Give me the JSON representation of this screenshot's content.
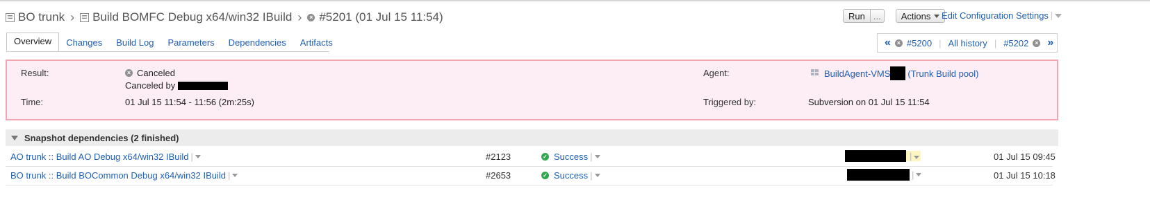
{
  "breadcrumb": {
    "project": "BO trunk",
    "build_config": "Build BOMFC Debug x64/win32 IBuild",
    "build": "#5201 (01 Jul 15 11:54)"
  },
  "toolbar": {
    "run_label": "Run",
    "run_more_label": "...",
    "actions_label": "Actions",
    "edit_config_label": "Edit Configuration Settings"
  },
  "tabs": [
    {
      "label": "Overview",
      "active": true
    },
    {
      "label": "Changes"
    },
    {
      "label": "Build Log"
    },
    {
      "label": "Parameters"
    },
    {
      "label": "Dependencies"
    },
    {
      "label": "Artifacts"
    }
  ],
  "history_nav": {
    "first_icon": "«",
    "prev_build": "#5200",
    "all_history": "All history",
    "next_build": "#5202",
    "last_icon": "»"
  },
  "result": {
    "result_label": "Result:",
    "result_value": "Canceled",
    "canceled_by_text": "Canceled by",
    "time_label": "Time:",
    "time_value": "01 Jul 15 11:54 - 11:56 (2m:25s)",
    "agent_label": "Agent:",
    "agent_name": "BuildAgent-VMS",
    "agent_pool": "(Trunk Build pool)",
    "triggered_label": "Triggered by:",
    "triggered_value": "Subversion on 01 Jul 15 11:54"
  },
  "dependencies": {
    "header": "Snapshot dependencies (2 finished)",
    "rows": [
      {
        "name": "AO trunk :: Build AO Debug x64/win32 IBuild",
        "number": "#2123",
        "status": "Success",
        "date": "01 Jul 15 09:45"
      },
      {
        "name": "BO trunk :: Build BOCommon Debug x64/win32 IBuild",
        "number": "#2653",
        "status": "Success",
        "date": "01 Jul 15 10:18"
      }
    ]
  },
  "colors": {
    "link": "#1f5fb5",
    "panel_bg": "#fdeef6",
    "panel_border": "#f0a6b3",
    "success": "#2fa84f"
  }
}
